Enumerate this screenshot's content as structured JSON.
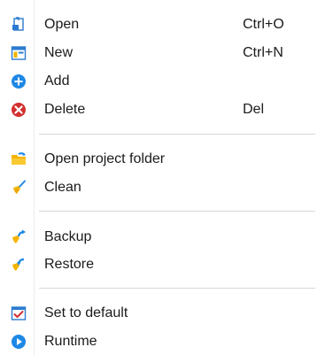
{
  "menu": {
    "items": [
      {
        "label": "Open",
        "shortcut": "Ctrl+O",
        "icon": "open-file-icon"
      },
      {
        "label": "New",
        "shortcut": "Ctrl+N",
        "icon": "new-window-icon"
      },
      {
        "label": "Add",
        "shortcut": "",
        "icon": "add-icon"
      },
      {
        "label": "Delete",
        "shortcut": "Del",
        "icon": "delete-icon"
      },
      {
        "label": "Open project folder",
        "shortcut": "",
        "icon": "folder-icon"
      },
      {
        "label": "Clean",
        "shortcut": "",
        "icon": "broom-icon"
      },
      {
        "label": "Backup",
        "shortcut": "",
        "icon": "backup-icon"
      },
      {
        "label": "Restore",
        "shortcut": "",
        "icon": "restore-icon"
      },
      {
        "label": "Set to default",
        "shortcut": "",
        "icon": "checklist-icon"
      },
      {
        "label": "Runtime",
        "shortcut": "",
        "icon": "play-icon"
      }
    ]
  },
  "colors": {
    "accent_blue": "#1e88e5",
    "delete_red": "#d32f2f",
    "folder_yellow": "#f4b400",
    "separator": "#d8d8d8"
  }
}
